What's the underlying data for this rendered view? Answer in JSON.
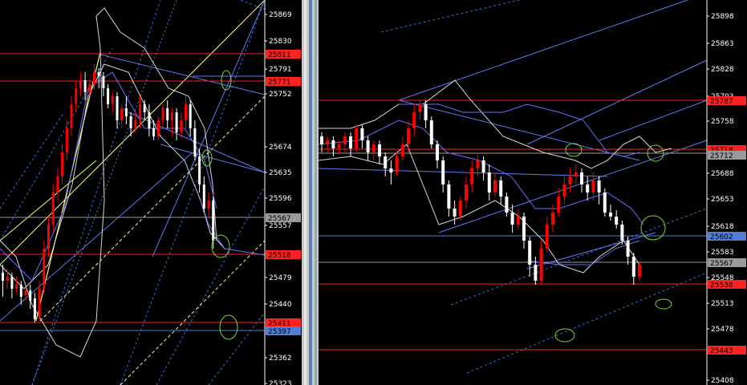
{
  "colors": {
    "background": "#000000",
    "axis": "#ffffff",
    "up_candle": "#ffffff",
    "down_candle": "#ff0000",
    "red_level": "#ff2020",
    "blue_level": "#4f7ed6",
    "grey_level": "#9a9a9a",
    "channel_yellow": "#ffff66",
    "channel_blue": "#5b7bf0",
    "dashed_blue": "#2f6fd8",
    "bollinger": "#d8d8d8",
    "envelope": "#6a6aff",
    "circle_marker": "#7dd63a"
  },
  "left_chart": {
    "axis_ticks": [
      "25869",
      "25830",
      "25791",
      "25752",
      "25674",
      "25635",
      "25596",
      "25557",
      "25479",
      "25440",
      "25362",
      "25323"
    ],
    "level_labels": [
      {
        "text": "25811",
        "color": "red"
      },
      {
        "text": "25771",
        "color": "red"
      },
      {
        "text": "25567",
        "color": "grey"
      },
      {
        "text": "25518",
        "color": "red"
      },
      {
        "text": "25411",
        "color": "red"
      },
      {
        "text": "25397",
        "color": "blue"
      }
    ],
    "icon": "green-circle-marker-icon"
  },
  "right_chart": {
    "axis_ticks": [
      "25898",
      "25863",
      "25828",
      "25793",
      "25758",
      "25688",
      "25653",
      "25618",
      "25583",
      "25548",
      "25513",
      "25478",
      "25408"
    ],
    "level_labels": [
      {
        "text": "25787",
        "color": "red"
      },
      {
        "text": "25718",
        "color": "red"
      },
      {
        "text": "25712",
        "color": "grey"
      },
      {
        "text": "25602",
        "color": "blue"
      },
      {
        "text": "25567",
        "color": "grey"
      },
      {
        "text": "25538",
        "color": "red"
      },
      {
        "text": "25443",
        "color": "red"
      }
    ],
    "icon": "green-circle-marker-icon"
  }
}
